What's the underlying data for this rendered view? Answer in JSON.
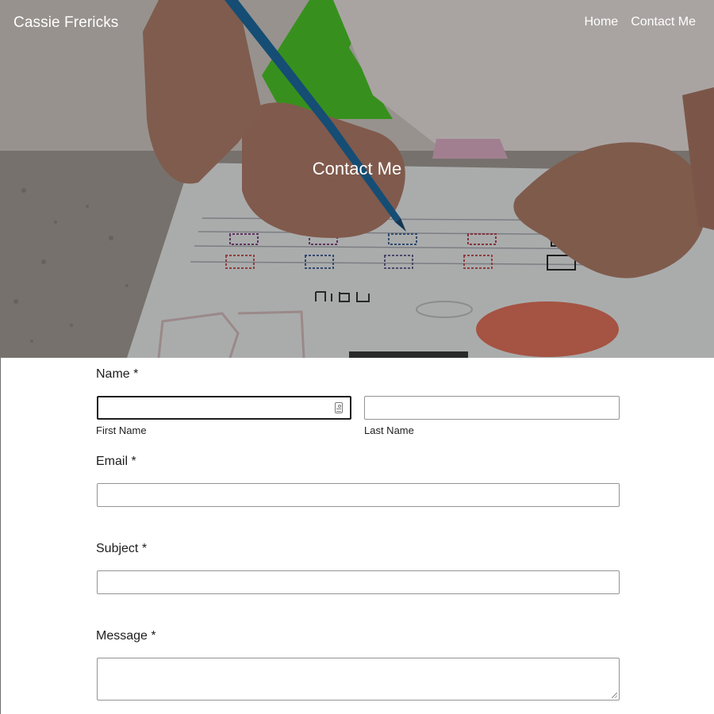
{
  "header": {
    "site_title": "Cassie Frericks",
    "nav": [
      {
        "label": "Home"
      },
      {
        "label": "Contact Me"
      }
    ]
  },
  "hero": {
    "heading": "Contact Me",
    "image_subject": "child-tracing-letters-photo"
  },
  "form": {
    "name": {
      "label": "Name *",
      "first": {
        "sublabel": "First Name",
        "value": "",
        "placeholder": ""
      },
      "last": {
        "sublabel": "Last Name",
        "value": "",
        "placeholder": ""
      }
    },
    "email": {
      "label": "Email *",
      "value": ""
    },
    "subject": {
      "label": "Subject *",
      "value": ""
    },
    "message": {
      "label": "Message *",
      "value": ""
    }
  },
  "colors": {
    "text": "#1e1e1e",
    "field_border": "#949494",
    "focus_border": "#1e1e1e",
    "hero_overlay": "rgba(0,0,0,0.30)"
  }
}
